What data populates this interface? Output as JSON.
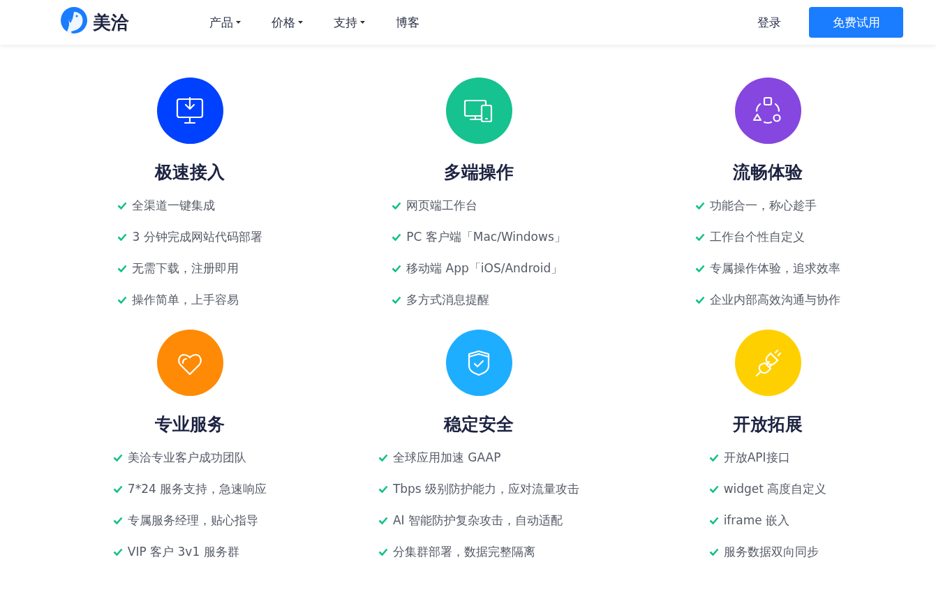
{
  "header": {
    "logo_text": "美洽",
    "nav": [
      {
        "label": "产品",
        "dropdown": true
      },
      {
        "label": "价格",
        "dropdown": true
      },
      {
        "label": "支持",
        "dropdown": true
      },
      {
        "label": "博客",
        "dropdown": false
      }
    ],
    "login": "登录",
    "cta": "免费试用"
  },
  "features": [
    {
      "kind": "monitor",
      "color": "#0041ff",
      "title": "极速接入",
      "items": [
        "全渠道一键集成",
        "3 分钟完成网站代码部署",
        "无需下载，注册即用",
        "操作简单，上手容易"
      ]
    },
    {
      "kind": "devices",
      "color": "#16c28f",
      "title": "多端操作",
      "items": [
        "网页端工作台",
        "PC 客户端「Mac/Windows」",
        "移动端 App「iOS/Android」",
        "多方式消息提醒"
      ]
    },
    {
      "kind": "shapes",
      "color": "#8646e0",
      "title": "流畅体验",
      "items": [
        "功能合一，称心趁手",
        "工作台个性自定义",
        "专属操作体验，追求效率",
        "企业内部高效沟通与协作"
      ]
    },
    {
      "kind": "heart",
      "color": "#ff8a05",
      "title": "专业服务",
      "items": [
        "美洽专业客户成功团队",
        "7*24 服务支持，急速响应",
        "专属服务经理，贴心指导",
        "VIP 客户 3v1 服务群"
      ]
    },
    {
      "kind": "shield",
      "color": "#1eaeff",
      "title": "稳定安全",
      "items": [
        "全球应用加速 GAAP",
        "Tbps 级别防护能力，应对流量攻击",
        "AI 智能防护复杂攻击，自动适配",
        "分集群部署，数据完整隔离"
      ]
    },
    {
      "kind": "plug",
      "color": "#ffd000",
      "title": "开放拓展",
      "items": [
        "开放API接口",
        "widget 高度自定义",
        "iframe 嵌入",
        "服务数据双向同步"
      ]
    }
  ]
}
